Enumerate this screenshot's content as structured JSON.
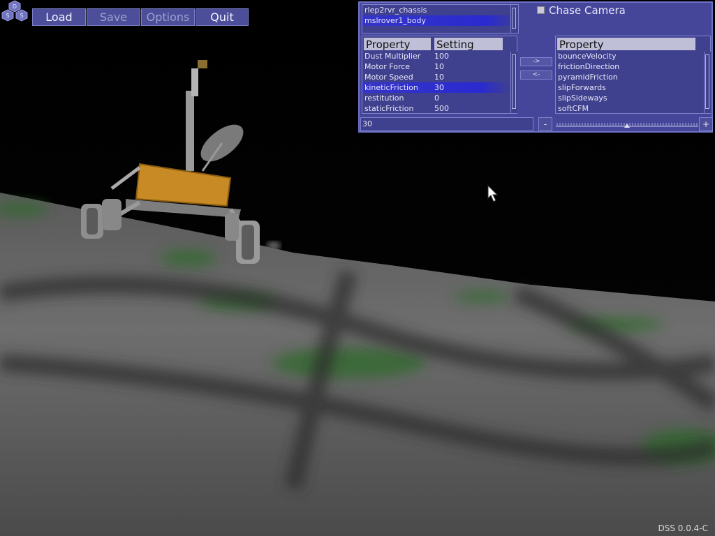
{
  "logo": {
    "letters": [
      "D",
      "S",
      "S"
    ]
  },
  "toolbar": {
    "load": "Load",
    "save": "Save",
    "options": "Options",
    "quit": "Quit"
  },
  "bodies": {
    "items": [
      "rlep2rvr_chassis",
      "mslrover1_body"
    ],
    "selected": 1
  },
  "chase_camera": {
    "label": "Chase Camera",
    "checked": false
  },
  "properties": {
    "header_property": "Property",
    "header_setting": "Setting",
    "rows": [
      {
        "name": "Dust Multiplier",
        "value": "100"
      },
      {
        "name": "Motor Force",
        "value": "10"
      },
      {
        "name": "Motor Speed",
        "value": "10"
      },
      {
        "name": "kineticFriction",
        "value": "30"
      },
      {
        "name": "restitution",
        "value": "0"
      },
      {
        "name": "staticFriction",
        "value": "500"
      }
    ],
    "selected": 3
  },
  "transfer": {
    "add": "->",
    "remove": "<-"
  },
  "available": {
    "header": "Property",
    "items": [
      "bounceVelocity",
      "frictionDirection",
      "pyramidFriction",
      "slipForwards",
      "slipSideways",
      "softCFM"
    ]
  },
  "value_field": "30",
  "slider": {
    "minus": "-",
    "plus": "+",
    "value_fraction": 0.5
  },
  "version": "DSS 0.0.4-C",
  "colors": {
    "panel": "#45469a",
    "selection": "#3030c8",
    "button": "#4c4e9a"
  }
}
